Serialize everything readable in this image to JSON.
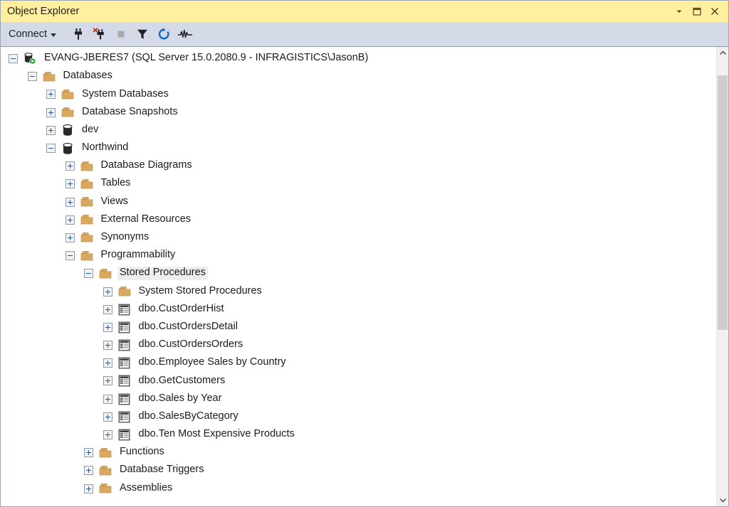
{
  "window": {
    "title": "Object Explorer",
    "controls": [
      {
        "name": "window-dropdown-button",
        "icon": "chevron-down-icon"
      },
      {
        "name": "window-maximize-button",
        "icon": "maximize-icon"
      },
      {
        "name": "window-close-button",
        "icon": "close-icon"
      }
    ]
  },
  "toolbar": {
    "connect_label": "Connect",
    "buttons": [
      {
        "name": "connect-object-explorer-button",
        "icon": "plug-connect-icon",
        "tooltip": "Connect",
        "enabled": true
      },
      {
        "name": "disconnect-button",
        "icon": "plug-disconnect-icon",
        "tooltip": "Disconnect",
        "enabled": true
      },
      {
        "name": "stop-button",
        "icon": "stop-square-icon",
        "tooltip": "Stop",
        "enabled": false
      },
      {
        "name": "filter-button",
        "icon": "funnel-filter-icon",
        "tooltip": "Filter",
        "enabled": true
      },
      {
        "name": "refresh-button",
        "icon": "refresh-circular-arrow-icon",
        "tooltip": "Refresh",
        "enabled": true
      },
      {
        "name": "activity-monitor-button",
        "icon": "activity-waveform-icon",
        "tooltip": "Activity Monitor",
        "enabled": true
      }
    ]
  },
  "colors": {
    "titlebar_bg": "#ffef9e",
    "toolbar_bg": "#d4dae8",
    "tree_bg": "#ffffff",
    "folder": "#d8a95f",
    "selection": "#eceded",
    "twisty_glyph": "#2b5797",
    "scrollbar_thumb": "#cdcdcd"
  },
  "tree": {
    "nodes": [
      {
        "depth": 0,
        "state": "expanded",
        "icon": "server-connected-icon",
        "label": "EVANG-JBERES7 (SQL Server 15.0.2080.9 - INFRAGISTICS\\JasonB)",
        "selected": false
      },
      {
        "depth": 1,
        "state": "expanded",
        "icon": "folder-icon",
        "label": "Databases",
        "selected": false
      },
      {
        "depth": 2,
        "state": "collapsed",
        "icon": "folder-icon",
        "label": "System Databases",
        "selected": false
      },
      {
        "depth": 2,
        "state": "collapsed",
        "icon": "folder-icon",
        "label": "Database Snapshots",
        "selected": false
      },
      {
        "depth": 2,
        "state": "collapsed",
        "icon": "database-icon",
        "label": "dev",
        "selected": false
      },
      {
        "depth": 2,
        "state": "expanded",
        "icon": "database-icon",
        "label": "Northwind",
        "selected": false
      },
      {
        "depth": 3,
        "state": "collapsed",
        "icon": "folder-icon",
        "label": "Database Diagrams",
        "selected": false
      },
      {
        "depth": 3,
        "state": "collapsed",
        "icon": "folder-icon",
        "label": "Tables",
        "selected": false
      },
      {
        "depth": 3,
        "state": "collapsed",
        "icon": "folder-icon",
        "label": "Views",
        "selected": false
      },
      {
        "depth": 3,
        "state": "collapsed",
        "icon": "folder-icon",
        "label": "External Resources",
        "selected": false
      },
      {
        "depth": 3,
        "state": "collapsed",
        "icon": "folder-icon",
        "label": "Synonyms",
        "selected": false
      },
      {
        "depth": 3,
        "state": "expanded",
        "icon": "folder-icon",
        "label": "Programmability",
        "selected": false
      },
      {
        "depth": 4,
        "state": "expanded",
        "icon": "folder-icon",
        "label": "Stored Procedures",
        "selected": true
      },
      {
        "depth": 5,
        "state": "collapsed",
        "icon": "folder-icon",
        "label": "System Stored Procedures",
        "selected": false
      },
      {
        "depth": 5,
        "state": "collapsed",
        "icon": "stored-procedure-icon",
        "label": "dbo.CustOrderHist",
        "selected": false
      },
      {
        "depth": 5,
        "state": "collapsed",
        "icon": "stored-procedure-icon",
        "label": "dbo.CustOrdersDetail",
        "selected": false
      },
      {
        "depth": 5,
        "state": "collapsed",
        "icon": "stored-procedure-icon",
        "label": "dbo.CustOrdersOrders",
        "selected": false
      },
      {
        "depth": 5,
        "state": "collapsed",
        "icon": "stored-procedure-icon",
        "label": "dbo.Employee Sales by Country",
        "selected": false
      },
      {
        "depth": 5,
        "state": "collapsed",
        "icon": "stored-procedure-icon",
        "label": "dbo.GetCustomers",
        "selected": false
      },
      {
        "depth": 5,
        "state": "collapsed",
        "icon": "stored-procedure-icon",
        "label": "dbo.Sales by Year",
        "selected": false
      },
      {
        "depth": 5,
        "state": "collapsed",
        "icon": "stored-procedure-icon",
        "label": "dbo.SalesByCategory",
        "selected": false
      },
      {
        "depth": 5,
        "state": "collapsed",
        "icon": "stored-procedure-icon",
        "label": "dbo.Ten Most Expensive Products",
        "selected": false
      },
      {
        "depth": 4,
        "state": "collapsed",
        "icon": "folder-icon",
        "label": "Functions",
        "selected": false
      },
      {
        "depth": 4,
        "state": "collapsed",
        "icon": "folder-icon",
        "label": "Database Triggers",
        "selected": false
      },
      {
        "depth": 4,
        "state": "collapsed",
        "icon": "folder-icon",
        "label": "Assemblies",
        "selected": false
      }
    ]
  },
  "scrollbar": {
    "up_arrow": "chevron-up-icon",
    "down_arrow": "chevron-down-icon",
    "thumb_top_pct": 3.5,
    "thumb_height_pct": 55.5
  }
}
